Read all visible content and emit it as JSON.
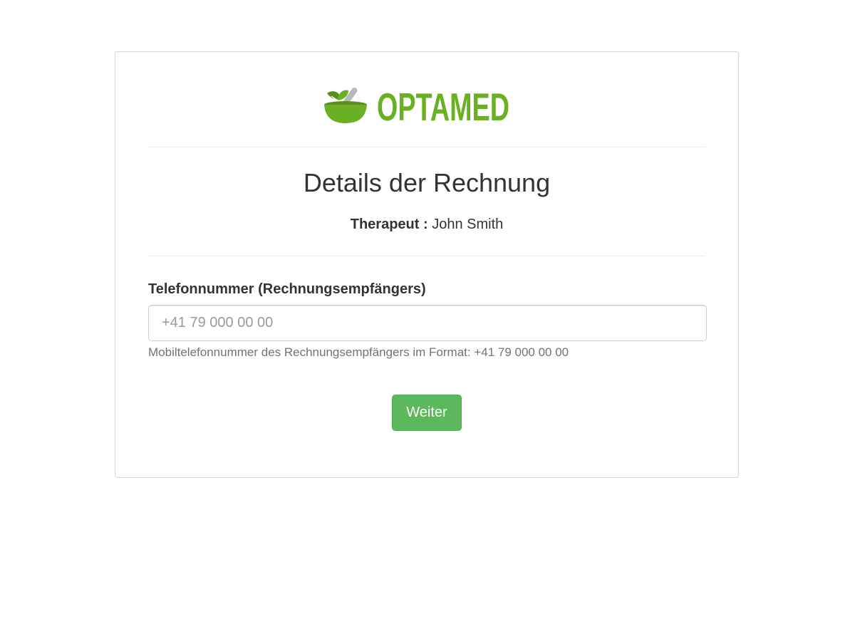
{
  "brand": {
    "name": "OPTAMED",
    "logo_icon": "mortar-pestle-leaves-icon",
    "color": "#6ab023"
  },
  "page": {
    "title": "Details der Rechnung"
  },
  "therapist": {
    "label": "Therapeut :",
    "name": "John Smith"
  },
  "form": {
    "phone_label": "Telefonnummer (Rechnungsempfängers)",
    "phone_value": "",
    "phone_placeholder": "+41 79 000 00 00",
    "phone_help": "Mobiltelefonnummer des Rechnungsempfängers im Format: +41 79 000 00 00",
    "submit_label": "Weiter"
  },
  "colors": {
    "accent": "#5cb85c",
    "text": "#333333",
    "help_text": "#737373"
  }
}
